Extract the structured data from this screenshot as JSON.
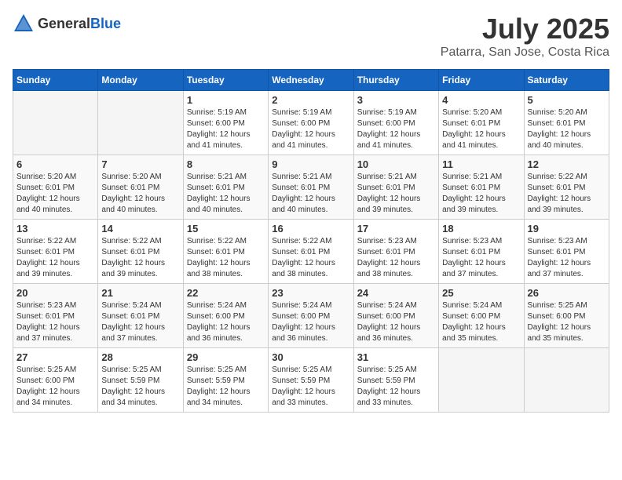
{
  "header": {
    "logo_general": "General",
    "logo_blue": "Blue",
    "month_year": "July 2025",
    "location": "Patarra, San Jose, Costa Rica"
  },
  "days_of_week": [
    "Sunday",
    "Monday",
    "Tuesday",
    "Wednesday",
    "Thursday",
    "Friday",
    "Saturday"
  ],
  "weeks": [
    [
      {
        "day": "",
        "info": ""
      },
      {
        "day": "",
        "info": ""
      },
      {
        "day": "1",
        "info": "Sunrise: 5:19 AM\nSunset: 6:00 PM\nDaylight: 12 hours\nand 41 minutes."
      },
      {
        "day": "2",
        "info": "Sunrise: 5:19 AM\nSunset: 6:00 PM\nDaylight: 12 hours\nand 41 minutes."
      },
      {
        "day": "3",
        "info": "Sunrise: 5:19 AM\nSunset: 6:00 PM\nDaylight: 12 hours\nand 41 minutes."
      },
      {
        "day": "4",
        "info": "Sunrise: 5:20 AM\nSunset: 6:01 PM\nDaylight: 12 hours\nand 41 minutes."
      },
      {
        "day": "5",
        "info": "Sunrise: 5:20 AM\nSunset: 6:01 PM\nDaylight: 12 hours\nand 40 minutes."
      }
    ],
    [
      {
        "day": "6",
        "info": "Sunrise: 5:20 AM\nSunset: 6:01 PM\nDaylight: 12 hours\nand 40 minutes."
      },
      {
        "day": "7",
        "info": "Sunrise: 5:20 AM\nSunset: 6:01 PM\nDaylight: 12 hours\nand 40 minutes."
      },
      {
        "day": "8",
        "info": "Sunrise: 5:21 AM\nSunset: 6:01 PM\nDaylight: 12 hours\nand 40 minutes."
      },
      {
        "day": "9",
        "info": "Sunrise: 5:21 AM\nSunset: 6:01 PM\nDaylight: 12 hours\nand 40 minutes."
      },
      {
        "day": "10",
        "info": "Sunrise: 5:21 AM\nSunset: 6:01 PM\nDaylight: 12 hours\nand 39 minutes."
      },
      {
        "day": "11",
        "info": "Sunrise: 5:21 AM\nSunset: 6:01 PM\nDaylight: 12 hours\nand 39 minutes."
      },
      {
        "day": "12",
        "info": "Sunrise: 5:22 AM\nSunset: 6:01 PM\nDaylight: 12 hours\nand 39 minutes."
      }
    ],
    [
      {
        "day": "13",
        "info": "Sunrise: 5:22 AM\nSunset: 6:01 PM\nDaylight: 12 hours\nand 39 minutes."
      },
      {
        "day": "14",
        "info": "Sunrise: 5:22 AM\nSunset: 6:01 PM\nDaylight: 12 hours\nand 39 minutes."
      },
      {
        "day": "15",
        "info": "Sunrise: 5:22 AM\nSunset: 6:01 PM\nDaylight: 12 hours\nand 38 minutes."
      },
      {
        "day": "16",
        "info": "Sunrise: 5:22 AM\nSunset: 6:01 PM\nDaylight: 12 hours\nand 38 minutes."
      },
      {
        "day": "17",
        "info": "Sunrise: 5:23 AM\nSunset: 6:01 PM\nDaylight: 12 hours\nand 38 minutes."
      },
      {
        "day": "18",
        "info": "Sunrise: 5:23 AM\nSunset: 6:01 PM\nDaylight: 12 hours\nand 37 minutes."
      },
      {
        "day": "19",
        "info": "Sunrise: 5:23 AM\nSunset: 6:01 PM\nDaylight: 12 hours\nand 37 minutes."
      }
    ],
    [
      {
        "day": "20",
        "info": "Sunrise: 5:23 AM\nSunset: 6:01 PM\nDaylight: 12 hours\nand 37 minutes."
      },
      {
        "day": "21",
        "info": "Sunrise: 5:24 AM\nSunset: 6:01 PM\nDaylight: 12 hours\nand 37 minutes."
      },
      {
        "day": "22",
        "info": "Sunrise: 5:24 AM\nSunset: 6:00 PM\nDaylight: 12 hours\nand 36 minutes."
      },
      {
        "day": "23",
        "info": "Sunrise: 5:24 AM\nSunset: 6:00 PM\nDaylight: 12 hours\nand 36 minutes."
      },
      {
        "day": "24",
        "info": "Sunrise: 5:24 AM\nSunset: 6:00 PM\nDaylight: 12 hours\nand 36 minutes."
      },
      {
        "day": "25",
        "info": "Sunrise: 5:24 AM\nSunset: 6:00 PM\nDaylight: 12 hours\nand 35 minutes."
      },
      {
        "day": "26",
        "info": "Sunrise: 5:25 AM\nSunset: 6:00 PM\nDaylight: 12 hours\nand 35 minutes."
      }
    ],
    [
      {
        "day": "27",
        "info": "Sunrise: 5:25 AM\nSunset: 6:00 PM\nDaylight: 12 hours\nand 34 minutes."
      },
      {
        "day": "28",
        "info": "Sunrise: 5:25 AM\nSunset: 5:59 PM\nDaylight: 12 hours\nand 34 minutes."
      },
      {
        "day": "29",
        "info": "Sunrise: 5:25 AM\nSunset: 5:59 PM\nDaylight: 12 hours\nand 34 minutes."
      },
      {
        "day": "30",
        "info": "Sunrise: 5:25 AM\nSunset: 5:59 PM\nDaylight: 12 hours\nand 33 minutes."
      },
      {
        "day": "31",
        "info": "Sunrise: 5:25 AM\nSunset: 5:59 PM\nDaylight: 12 hours\nand 33 minutes."
      },
      {
        "day": "",
        "info": ""
      },
      {
        "day": "",
        "info": ""
      }
    ]
  ]
}
